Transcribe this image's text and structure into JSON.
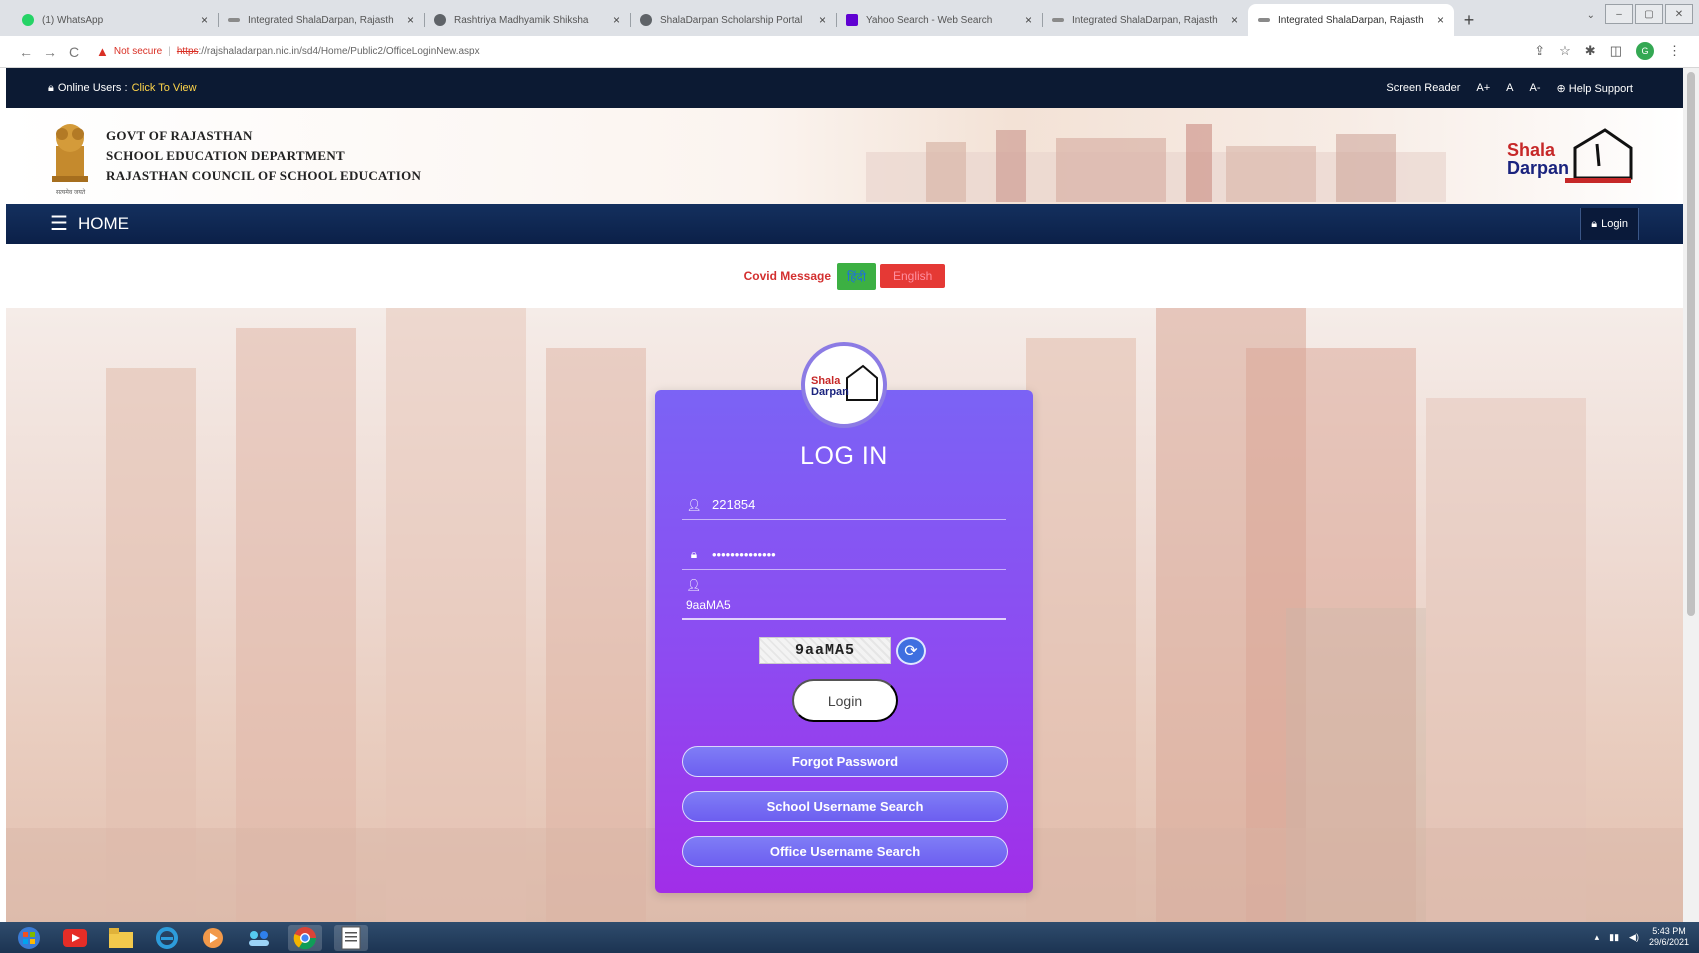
{
  "browser": {
    "tabs": [
      {
        "title": "(1) WhatsApp",
        "fav_color": "#25d366",
        "active": false
      },
      {
        "title": "Integrated ShalaDarpan, Rajasth",
        "fav_color": "#8a8a8a",
        "active": false
      },
      {
        "title": "Rashtriya Madhyamik Shiksha",
        "fav_color": "#5f6368",
        "active": false
      },
      {
        "title": "ShalaDarpan Scholarship Portal",
        "fav_color": "#5f6368",
        "active": false
      },
      {
        "title": "Yahoo Search - Web Search",
        "fav_color": "#6001d2",
        "active": false
      },
      {
        "title": "Integrated ShalaDarpan, Rajasth",
        "fav_color": "#8a8a8a",
        "active": false
      },
      {
        "title": "Integrated ShalaDarpan, Rajasth",
        "fav_color": "#8a8a8a",
        "active": true
      }
    ],
    "new_tab": "+",
    "close_glyph": "×",
    "not_secure": "Not secure",
    "url_https": "https",
    "url_rest": "://rajshaladarpan.nic.in/sd4/Home/Public2/OfficeLoginNew.aspx"
  },
  "topbar": {
    "online_prefix": "Online Users :",
    "online_link": "Click To View",
    "screen_reader": "Screen Reader",
    "font_plus": "A+",
    "font_normal": "A",
    "font_minus": "A-",
    "help": "Help Support"
  },
  "header": {
    "line1": "GOVT OF RAJASTHAN",
    "line2": "SCHOOL EDUCATION DEPARTMENT",
    "line3": "RAJASTHAN COUNCIL OF SCHOOL EDUCATION",
    "emblem_caption": "सत्यमेव जयते",
    "logo_word1": "Shala",
    "logo_word2": "Darpan"
  },
  "nav": {
    "home": "HOME",
    "login": "Login"
  },
  "covid": {
    "label": "Covid Message",
    "hindi": "हिंदी",
    "english": "English"
  },
  "login_card": {
    "title": "LOG IN",
    "username_value": "221854",
    "password_value": "••••••••••••••",
    "captcha_input_value": "9aaMA5",
    "captcha_text": "9aaMA5",
    "login_button": "Login",
    "forgot_password": "Forgot Password",
    "school_username_search": "School Username Search",
    "office_username_search": "Office Username Search"
  },
  "taskbar": {
    "time": "5:43 PM",
    "date": "29/6/2021"
  },
  "colors": {
    "topbar": "#0c1a33",
    "navbar": "#14305e",
    "card_top": "#7b63f5",
    "card_bottom": "#a12ee8",
    "covid_label": "#d32f2f"
  }
}
